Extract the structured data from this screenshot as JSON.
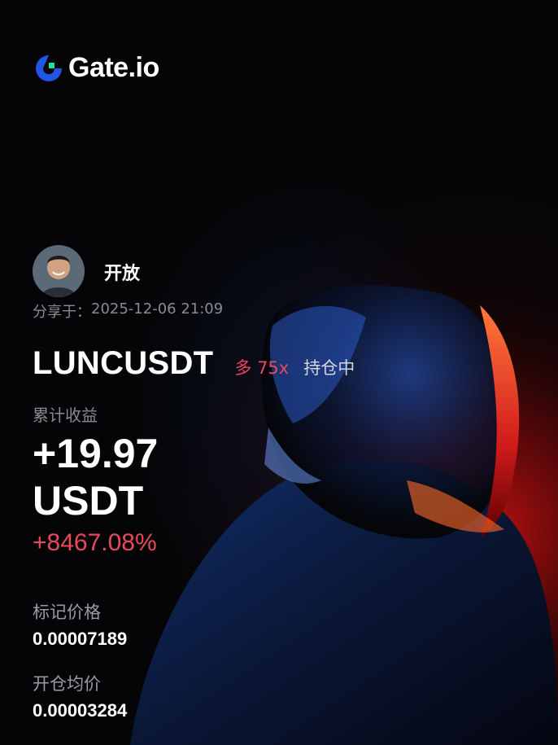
{
  "brand": {
    "name": "Gate.io",
    "accent_color": "#2354e6",
    "accent_green": "#17e6a1"
  },
  "user": {
    "name": "开放",
    "share_label": "分享于：",
    "share_time": "2025-12-06 21:09",
    "avatar_icon": "user-avatar"
  },
  "position": {
    "pair": "LUNCUSDT",
    "side": "多 75x",
    "status": "持仓中",
    "side_color": "#e9495c"
  },
  "pnl": {
    "label": "累计收益",
    "value": "+19.97",
    "unit": "USDT",
    "percent": "+8467.08%"
  },
  "prices": {
    "mark_label": "标记价格",
    "mark_value": "0.00007189",
    "entry_label": "开仓均价",
    "entry_value": "0.00003284"
  }
}
